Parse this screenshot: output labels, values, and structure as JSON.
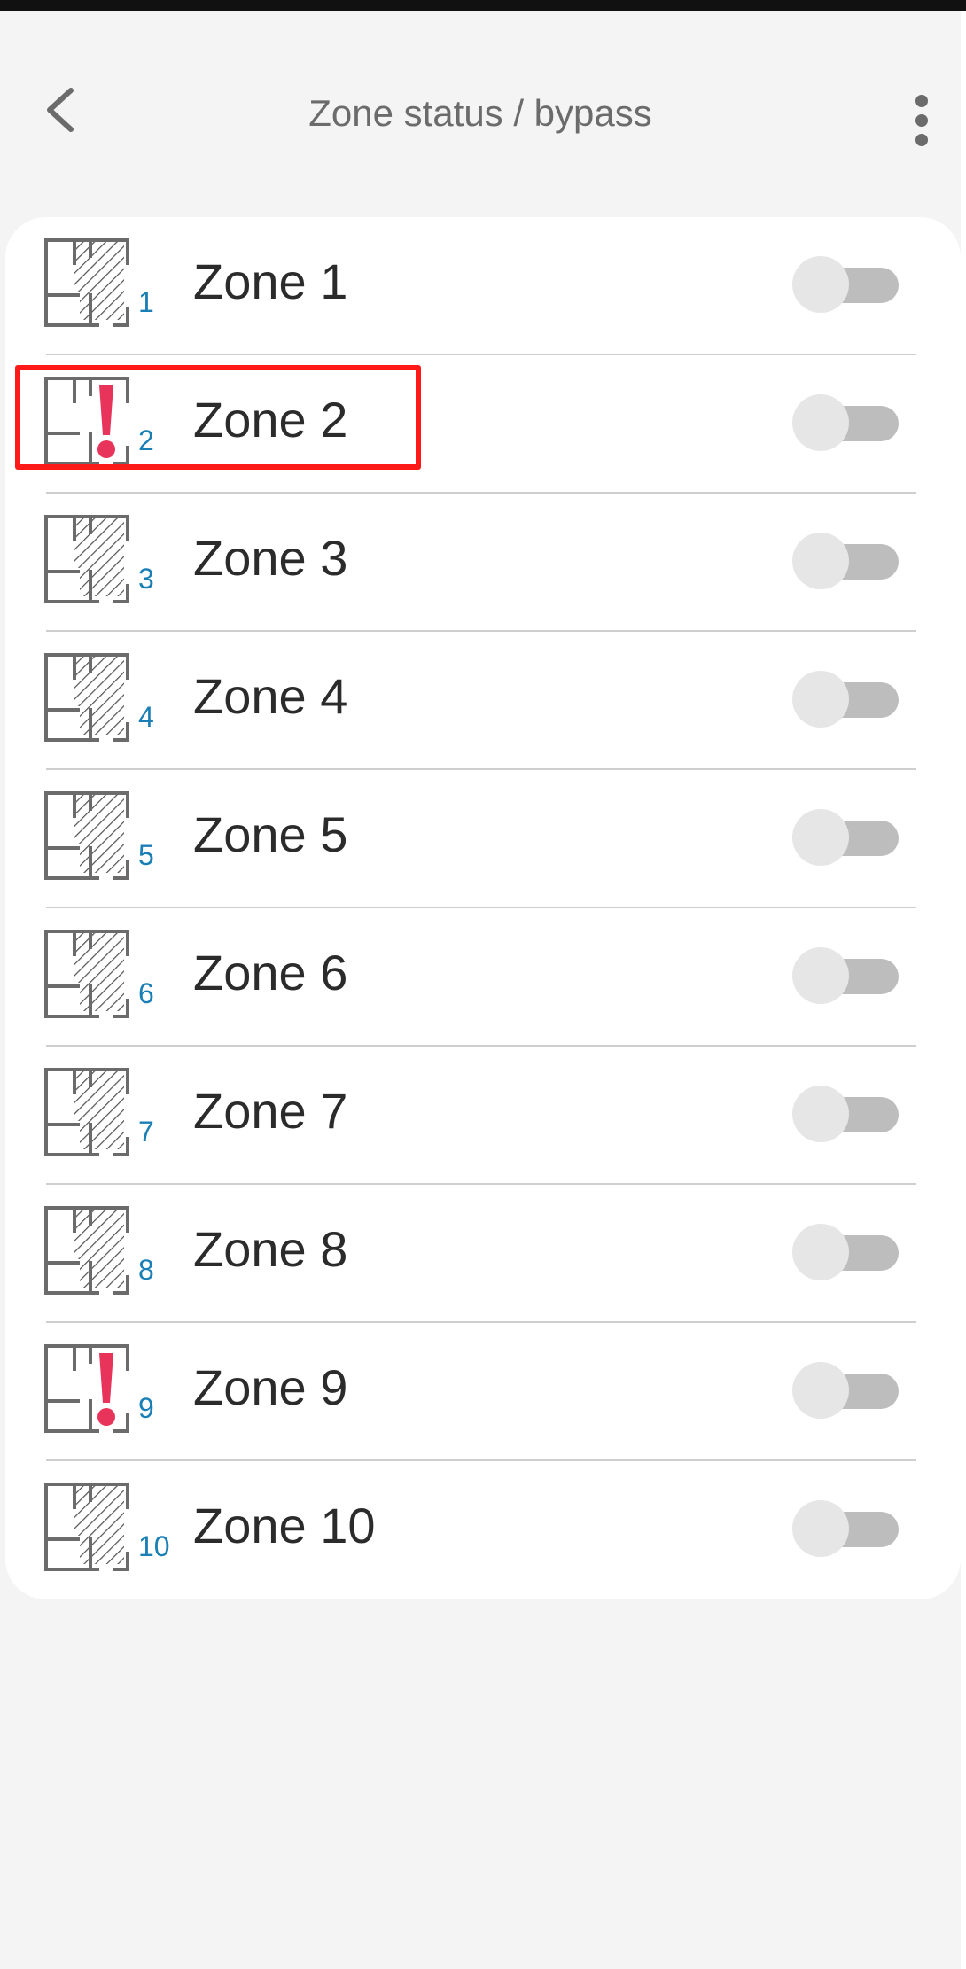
{
  "header": {
    "title": "Zone status / bypass",
    "back_icon": "chevron-left-icon",
    "more_icon": "more-vertical-icon"
  },
  "colors": {
    "background": "#f4f4f4",
    "card": "#ffffff",
    "title": "#6b6b6b",
    "zone_number": "#1a7fb5",
    "alarm": "#e8345a",
    "highlight": "#ff1a1a",
    "toggle_track": "#bdbdbd",
    "toggle_thumb": "#e6e6e6"
  },
  "zones": [
    {
      "num": "1",
      "label": "Zone 1",
      "status_icon": "floorplan-zone-icon",
      "bypass": false
    },
    {
      "num": "2",
      "label": "Zone 2",
      "status_icon": "floorplan-alarm-icon",
      "bypass": false
    },
    {
      "num": "3",
      "label": "Zone 3",
      "status_icon": "floorplan-zone-icon",
      "bypass": false
    },
    {
      "num": "4",
      "label": "Zone 4",
      "status_icon": "floorplan-zone-icon",
      "bypass": false
    },
    {
      "num": "5",
      "label": "Zone 5",
      "status_icon": "floorplan-zone-icon",
      "bypass": false
    },
    {
      "num": "6",
      "label": "Zone 6",
      "status_icon": "floorplan-zone-icon",
      "bypass": false
    },
    {
      "num": "7",
      "label": "Zone 7",
      "status_icon": "floorplan-zone-icon",
      "bypass": false
    },
    {
      "num": "8",
      "label": "Zone 8",
      "status_icon": "floorplan-zone-icon",
      "bypass": false
    },
    {
      "num": "9",
      "label": "Zone 9",
      "status_icon": "floorplan-alarm-icon",
      "bypass": false
    },
    {
      "num": "10",
      "label": "Zone 10",
      "status_icon": "floorplan-zone-icon",
      "bypass": false
    }
  ]
}
